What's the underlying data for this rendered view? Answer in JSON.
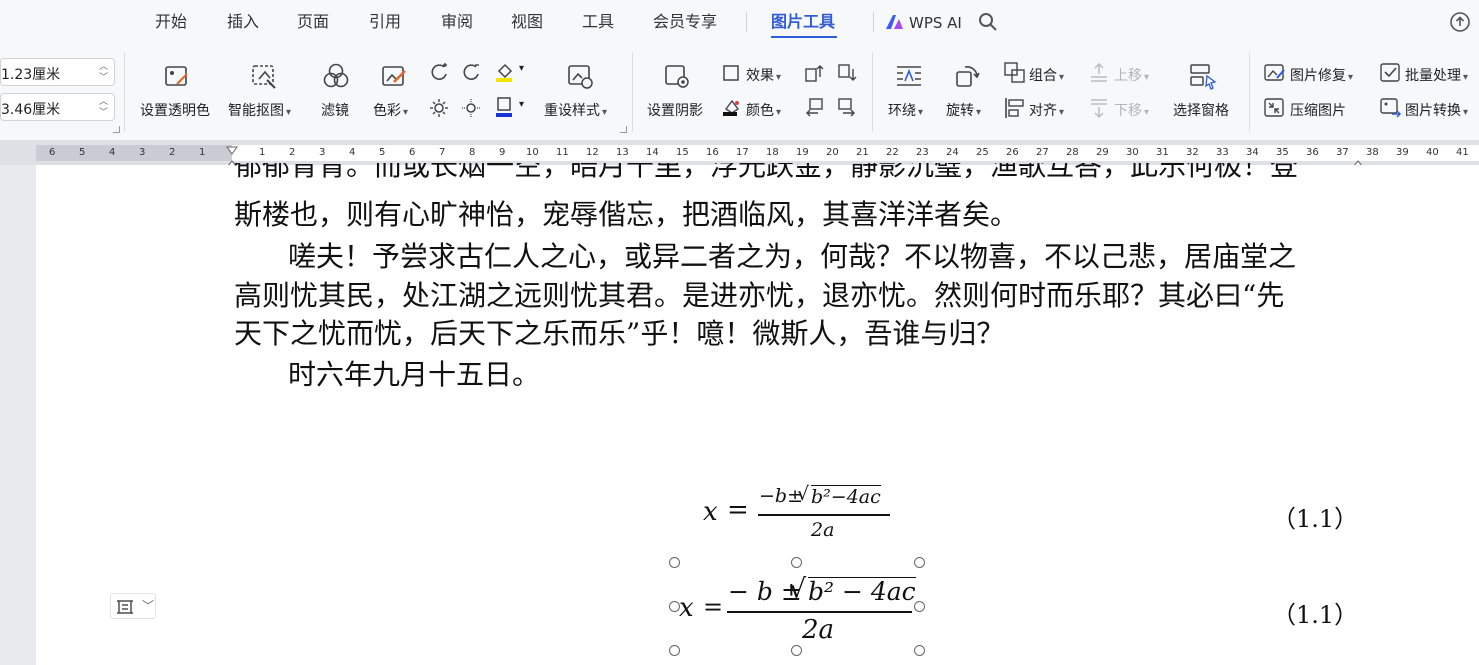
{
  "menu": {
    "tabs": [
      "开始",
      "插入",
      "页面",
      "引用",
      "审阅",
      "视图",
      "工具",
      "会员专享",
      "图片工具"
    ],
    "active": "图片工具",
    "ai_label": "WPS AI"
  },
  "ribbon": {
    "width_value": "1.23厘米",
    "height_value": "3.46厘米",
    "set_transparent": "设置透明色",
    "smart_cutout": "智能抠图",
    "filter": "滤镜",
    "color": "色彩",
    "reset_style": "重设样式",
    "set_shadow": "设置阴影",
    "effect": "效果",
    "shadow_color": "颜色",
    "wrap": "环绕",
    "rotate": "旋转",
    "group": "组合",
    "align": "对齐",
    "bring_forward": "上移",
    "send_backward": "下移",
    "selection_pane": "选择窗格",
    "image_repair": "图片修复",
    "batch_process": "批量处理",
    "compress_image": "压缩图片",
    "image_convert": "图片转换",
    "accent_yellow": "#f5e400",
    "accent_blue": "#1a33d6"
  },
  "ruler": {
    "left_numbers": [
      "6",
      "5",
      "4",
      "3",
      "2",
      "1"
    ],
    "right_numbers": [
      "1",
      "2",
      "3",
      "4",
      "5",
      "6",
      "7",
      "8",
      "9",
      "10",
      "11",
      "12",
      "13",
      "14",
      "15",
      "16",
      "17",
      "18",
      "19",
      "20",
      "21",
      "22",
      "23",
      "24",
      "25",
      "26",
      "27",
      "28",
      "29",
      "30",
      "31",
      "32",
      "33",
      "34",
      "35",
      "36",
      "37",
      "38",
      "39",
      "40",
      "41"
    ]
  },
  "document": {
    "lines": [
      "郁郁青青。而或长烟一空，皓月千里，浮光跃金，静影沉璧，渔歌互答，此乐何极！登",
      "斯楼也，则有心旷神怡，宠辱偕忘，把酒临风，其喜洋洋者矣。",
      "嗟夫！予尝求古仁人之心，或异二者之为，何哉？不以物喜，不以己悲，居庙堂之",
      "高则忧其民，处江湖之远则忧其君。是进亦忧，退亦忧。然则何时而乐耶？其必曰“先",
      "天下之忧而忧，后天下之乐而乐”乎！噫！微斯人，吾谁与归？",
      "时六年九月十五日。"
    ],
    "eq1": {
      "lhs": "x",
      "eq": "=",
      "numerator_pre": "−b±",
      "radicand": "b²−4ac",
      "denominator": "2a",
      "number": "（1.1）"
    },
    "eq2": {
      "lhs": "x",
      "eq": "=",
      "numerator_pre": "− b ±",
      "radicand": "b² − 4ac",
      "denominator": "2a",
      "number": "（1.1）"
    }
  }
}
